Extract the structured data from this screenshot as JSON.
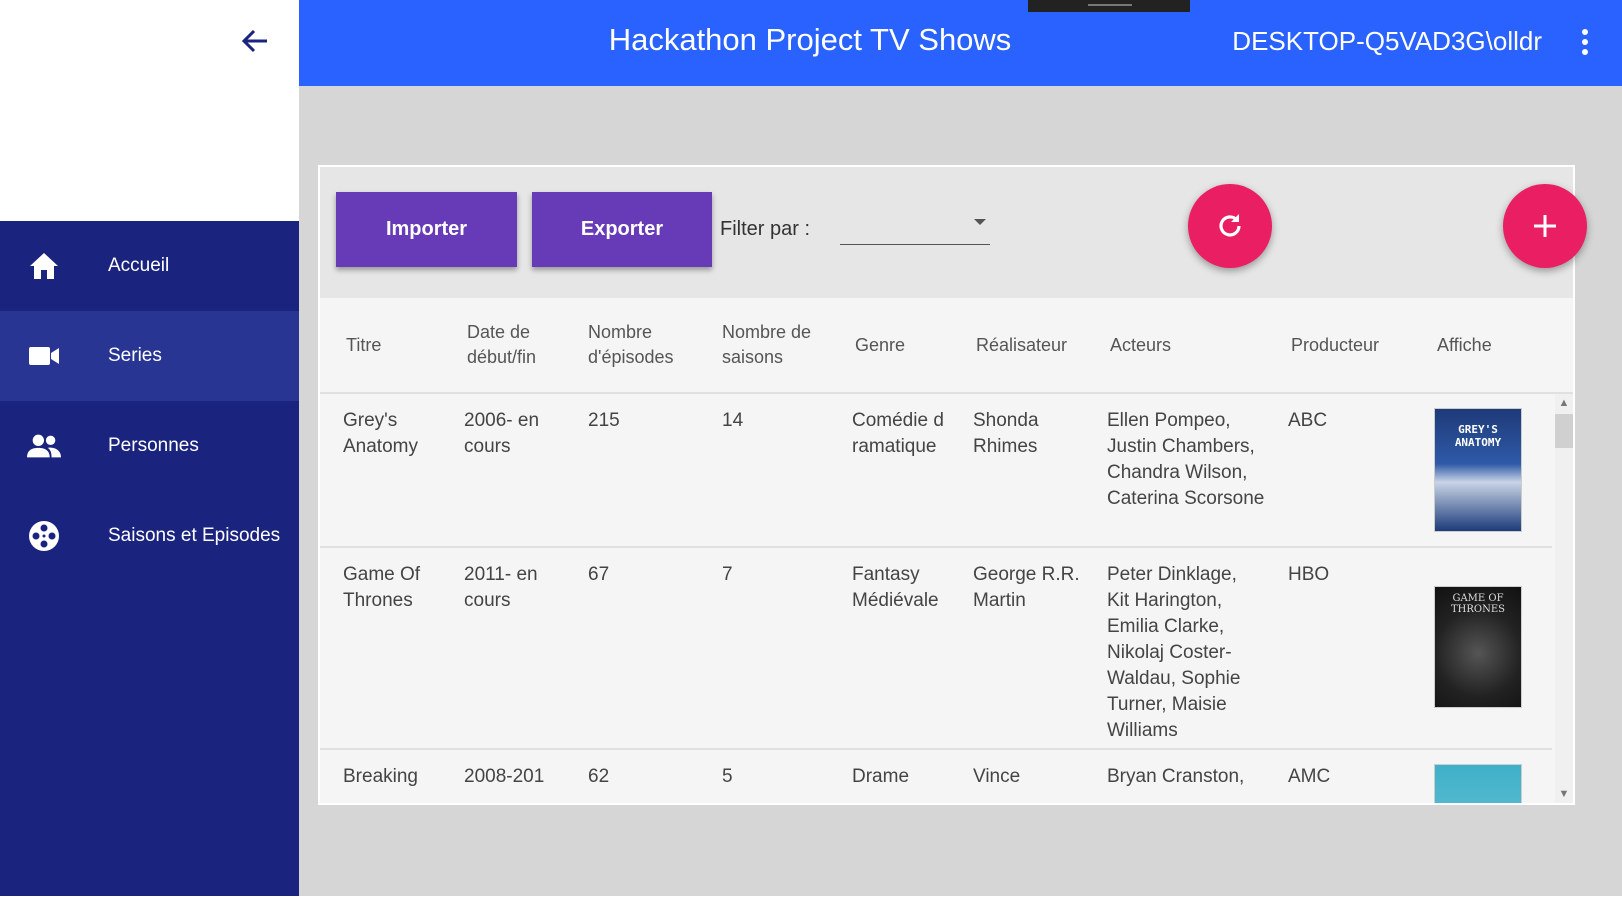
{
  "header": {
    "title": "Hackathon Project TV Shows",
    "user": "DESKTOP-Q5VAD3G\\olldr"
  },
  "sidebar": {
    "items": [
      {
        "label": "Accueil",
        "icon": "home-icon"
      },
      {
        "label": "Series",
        "icon": "video-camera-icon",
        "active": true
      },
      {
        "label": "Personnes",
        "icon": "people-icon"
      },
      {
        "label": "Saisons et Episodes",
        "icon": "film-reel-icon"
      }
    ]
  },
  "toolbar": {
    "import_label": "Importer",
    "export_label": "Exporter",
    "filter_label": "Filter par :",
    "filter_value": ""
  },
  "table": {
    "columns": [
      "Titre",
      "Date de début/fin",
      "Nombre d'épisodes",
      "Nombre de saisons",
      "Genre",
      "Réalisateur",
      "Acteurs",
      "Producteur",
      "Affiche"
    ],
    "rows": [
      {
        "titre": "Grey's Anatomy",
        "dates": "2006- en cours",
        "episodes": "215",
        "saisons": "14",
        "genre": "Comédie dramatique",
        "realisateur": "Shonda Rhimes",
        "acteurs": "Ellen Pompeo, Justin Chambers, Chandra Wilson, Caterina Scorsone",
        "producteur": "ABC",
        "affiche": "GREY'S ANATOMY"
      },
      {
        "titre": "Game Of Thrones",
        "dates": "2011- en cours",
        "episodes": "67",
        "saisons": "7",
        "genre": "Fantasy Médiévale",
        "realisateur": "George R.R. Martin",
        "acteurs": "Peter Dinklage, Kit Harington, Emilia Clarke, Nikolaj Coster-Waldau, Sophie Turner, Maisie Williams",
        "producteur": "HBO",
        "affiche": "GAME OF THRONES"
      },
      {
        "titre": "Breaking",
        "dates": "2008-201",
        "episodes": "62",
        "saisons": "5",
        "genre": "Drame",
        "realisateur": "Vince",
        "acteurs": "Bryan Cranston,",
        "producteur": "AMC",
        "affiche": ""
      }
    ]
  },
  "colors": {
    "appbar": "#2962ff",
    "sidebar": "#1a237e",
    "button": "#673ab7",
    "fab": "#e91e63"
  }
}
